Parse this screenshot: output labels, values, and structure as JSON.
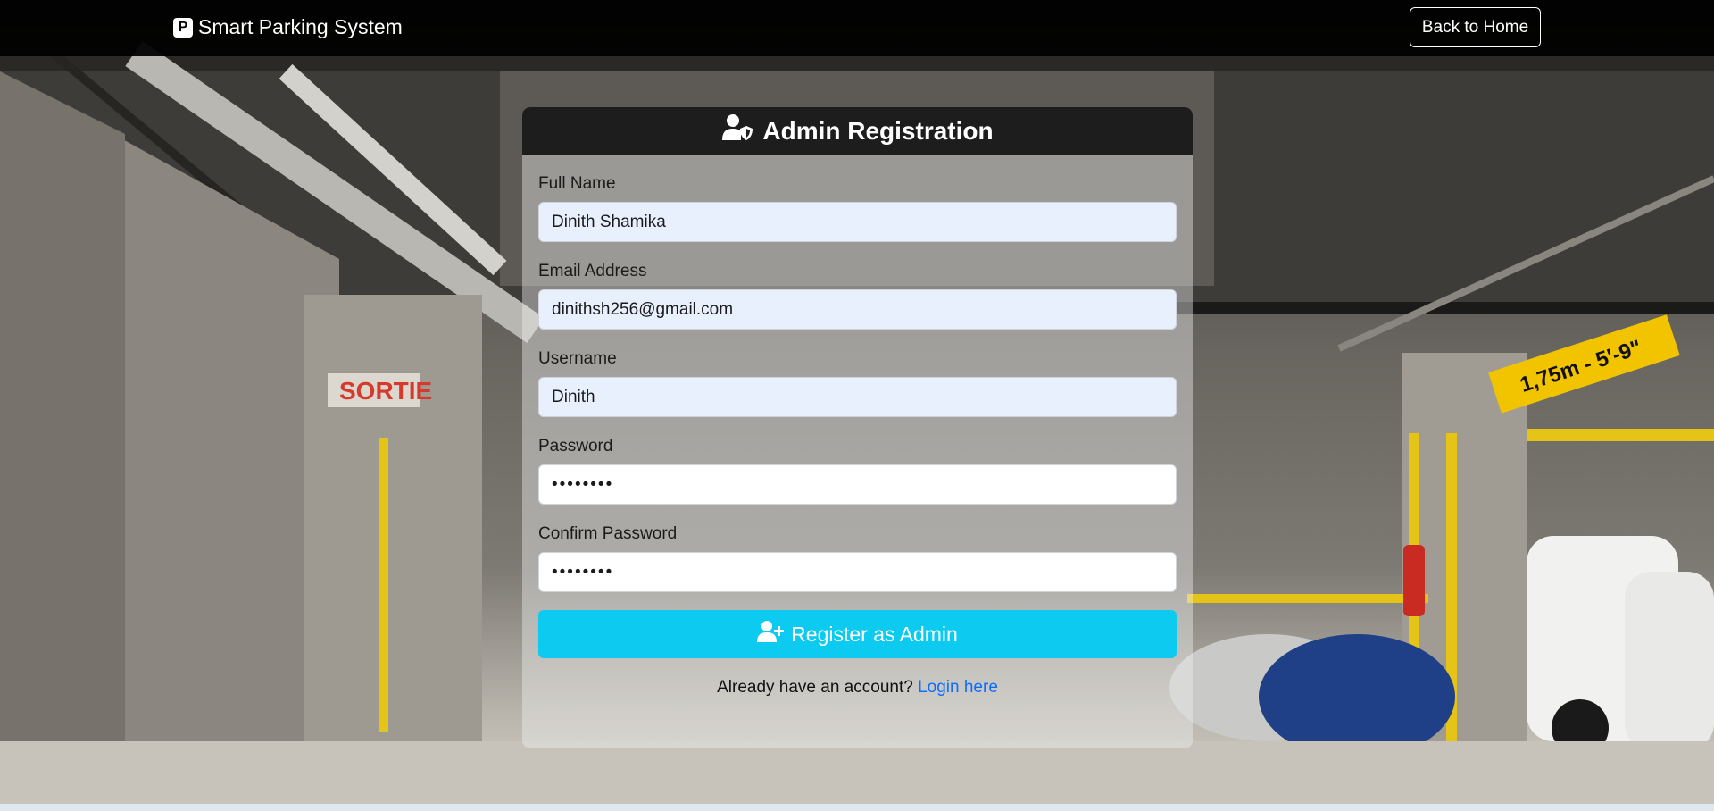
{
  "navbar": {
    "brand_icon": "P",
    "brand_label": "Smart Parking System",
    "back_label": "Back to Home"
  },
  "card": {
    "title": "Admin Registration",
    "title_icon": "user-shield-icon",
    "fields": [
      {
        "label": "Full Name",
        "value": "Dinith Shamika"
      },
      {
        "label": "Email Address",
        "value": "dinithsh256@gmail.com"
      },
      {
        "label": "Username",
        "value": "Dinith"
      },
      {
        "label": "Password",
        "value": "••••••••"
      },
      {
        "label": "Confirm Password",
        "value": "••••••••"
      }
    ],
    "register_label": "Register as Admin",
    "register_icon": "user-plus-icon",
    "login_prompt": "Already have an account?",
    "login_link": "Login here"
  },
  "background": {
    "sign_exit": "SORTIE",
    "sign_clearance": "1,75m - 5'-9\""
  },
  "colors": {
    "navbar": "#000000",
    "card_header": "#1d1d1d",
    "register_button": "#0dcaf0",
    "link": "#0d6efd",
    "autofill_input": "#e8f0fe"
  }
}
